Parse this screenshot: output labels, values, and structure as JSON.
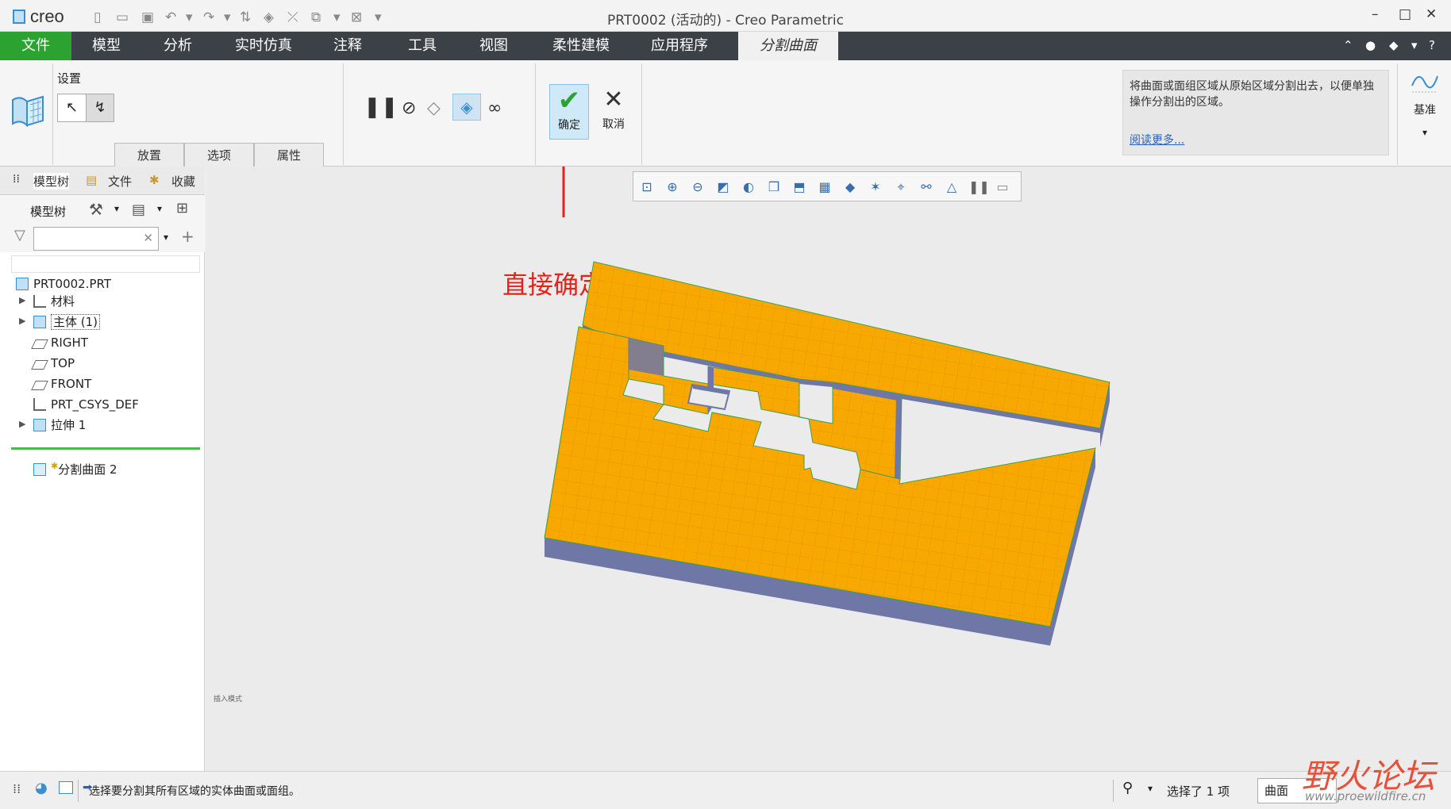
{
  "app": {
    "logo_text": "creo",
    "window_title": "PRT0002 (活动的) - Creo Parametric"
  },
  "menu": {
    "items": [
      "文件",
      "模型",
      "分析",
      "实时仿真",
      "注释",
      "工具",
      "视图",
      "柔性建模",
      "应用程序",
      "分割曲面"
    ]
  },
  "ribbon": {
    "settings_label": "设置",
    "subtabs": [
      "放置",
      "选项",
      "属性"
    ],
    "ok_label": "确定",
    "cancel_label": "取消",
    "help_text": "将曲面或面组区域从原始区域分割出去，以便单独操作分割出的区域。",
    "help_link": "阅读更多...",
    "datum_label": "基准"
  },
  "panel": {
    "tabs": [
      "模型树",
      "文件",
      "收藏"
    ],
    "tree_label": "模型树",
    "tree_items": [
      "PRT0002.PRT",
      "材料",
      "主体 (1)",
      "RIGHT",
      "TOP",
      "FRONT",
      "PRT_CSYS_DEF",
      "拉伸 1",
      "分割曲面 2"
    ]
  },
  "graphics": {
    "annotation": "直接确定",
    "mode_label": "插入模式"
  },
  "status": {
    "message": "选择要分割其所有区域的实体曲面或面组。",
    "selection_count": "选择了 1 项",
    "filter_value": "曲面"
  },
  "watermark": {
    "text": "野火论坛",
    "url": "www.proewildfire.cn"
  },
  "colors": {
    "menu_bg": "#3c4148",
    "file_tab": "#2ca331",
    "model_top": "#f8a800",
    "model_side": "#6f77a7",
    "annotation": "#e3221a"
  }
}
